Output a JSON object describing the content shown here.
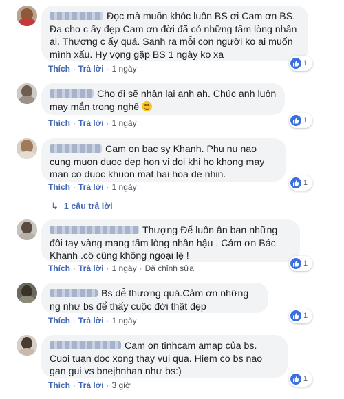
{
  "colors": {
    "link": "#4267b2",
    "bubble": "#f2f3f5",
    "like_icon": "#3b6fe0"
  },
  "actions": {
    "like": "Thích",
    "reply": "Trả lời",
    "edited": "Đã chỉnh sửa"
  },
  "reaction_icon": "thumbs-up-icon",
  "comments": [
    {
      "text": "Đọc mà muốn khóc luôn BS ơi Cam ơn BS. Đa cho c ấy đẹp Cam ơn đời đã có những tấm lòng nhân ai. Thương c ấy quá. Sanh ra mỗi con người ko ai muốn mình xấu. Hy vọng gặp BS 1 ngày ko xa",
      "time": "1 ngày",
      "likes": "1"
    },
    {
      "text": "Cho đi sẽ nhận lại anh ah. Chúc anh luôn may mắn trong nghề",
      "emoji": "smiling-face-emoji",
      "time": "1 ngày",
      "likes": "1"
    },
    {
      "text": "Cam on bac sy Khanh. Phu nu nao cung muon duoc dep hon vi doi khi ho khong may man co duoc khuon mat hai hoa de nhin.",
      "time": "1 ngày",
      "likes": "1",
      "replies": "1 câu trả lời"
    },
    {
      "text": "Thượng Để luôn ân ban những đôi tay vàng mang tấm lòng nhân hậu . Cảm ơn Bác Khanh .cô cũng không ngoại lệ !",
      "time": "1 ngày",
      "likes": "1"
    },
    {
      "text": "Bs dễ thương quá.Cảm ơn những ng như bs để thấy cuộc đời thật đẹp",
      "time": "1 ngày",
      "likes": "1"
    },
    {
      "text": "Cam on tinhcam amap của bs. Cuoi tuan doc xong thay vui qua. Hiem co bs nao gan gui vs bnejhnhan như bs:)",
      "time": "3 giờ",
      "likes": "1"
    }
  ]
}
